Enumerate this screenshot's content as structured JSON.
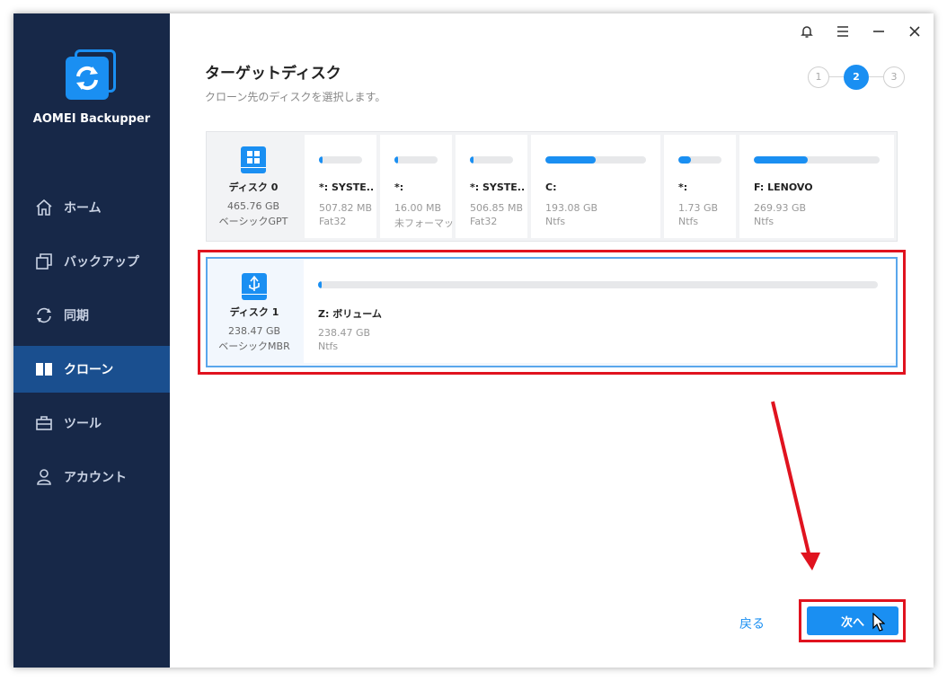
{
  "app": {
    "name": "AOMEI Backupper"
  },
  "titlebar": {
    "bell_icon": "bell-icon",
    "menu_icon": "menu-icon",
    "minimize_icon": "minimize-icon",
    "close_icon": "close-icon"
  },
  "sidebar": {
    "items": [
      {
        "label": "ホーム",
        "icon": "home-icon",
        "active": false
      },
      {
        "label": "バックアップ",
        "icon": "backup-icon",
        "active": false
      },
      {
        "label": "同期",
        "icon": "sync-icon",
        "active": false
      },
      {
        "label": "クローン",
        "icon": "clone-icon",
        "active": true
      },
      {
        "label": "ツール",
        "icon": "tools-icon",
        "active": false
      },
      {
        "label": "アカウント",
        "icon": "account-icon",
        "active": false
      }
    ]
  },
  "header": {
    "title": "ターゲットディスク",
    "subtitle": "クローン先のディスクを選択します。",
    "steps": [
      "1",
      "2",
      "3"
    ],
    "active_step": 2
  },
  "disks": [
    {
      "name": "ディスク 0",
      "size": "465.76 GB",
      "type": "ベーシックGPT",
      "icon": "windows-disk-icon",
      "partitions": [
        {
          "label": "*: SYSTE...",
          "size": "507.82 MB",
          "fs": "Fat32",
          "used": 0.04
        },
        {
          "label": "*:",
          "size": "16.00 MB",
          "fs": "未フォーマット",
          "used": 0.04
        },
        {
          "label": "*: SYSTE...",
          "size": "506.85 MB",
          "fs": "Fat32",
          "used": 0.04
        },
        {
          "label": "C:",
          "size": "193.08 GB",
          "fs": "Ntfs",
          "used": 0.5
        },
        {
          "label": "*:",
          "size": "1.73 GB",
          "fs": "Ntfs",
          "used": 0.3
        },
        {
          "label": "F: LENOVO",
          "size": "269.93 GB",
          "fs": "Ntfs",
          "used": 0.43
        }
      ]
    },
    {
      "name": "ディスク 1",
      "size": "238.47 GB",
      "type": "ベーシックMBR",
      "icon": "usb-disk-icon",
      "selected": true,
      "partitions": [
        {
          "label": "Z: ボリューム",
          "size": "238.47 GB",
          "fs": "Ntfs",
          "used": 0.005
        }
      ]
    }
  ],
  "footer": {
    "back_label": "戻る",
    "next_label": "次へ"
  },
  "colors": {
    "accent": "#1a8ff2",
    "sidebar": "#172848",
    "sidebar_active": "#1a4f8f",
    "highlight": "#e0131f"
  }
}
